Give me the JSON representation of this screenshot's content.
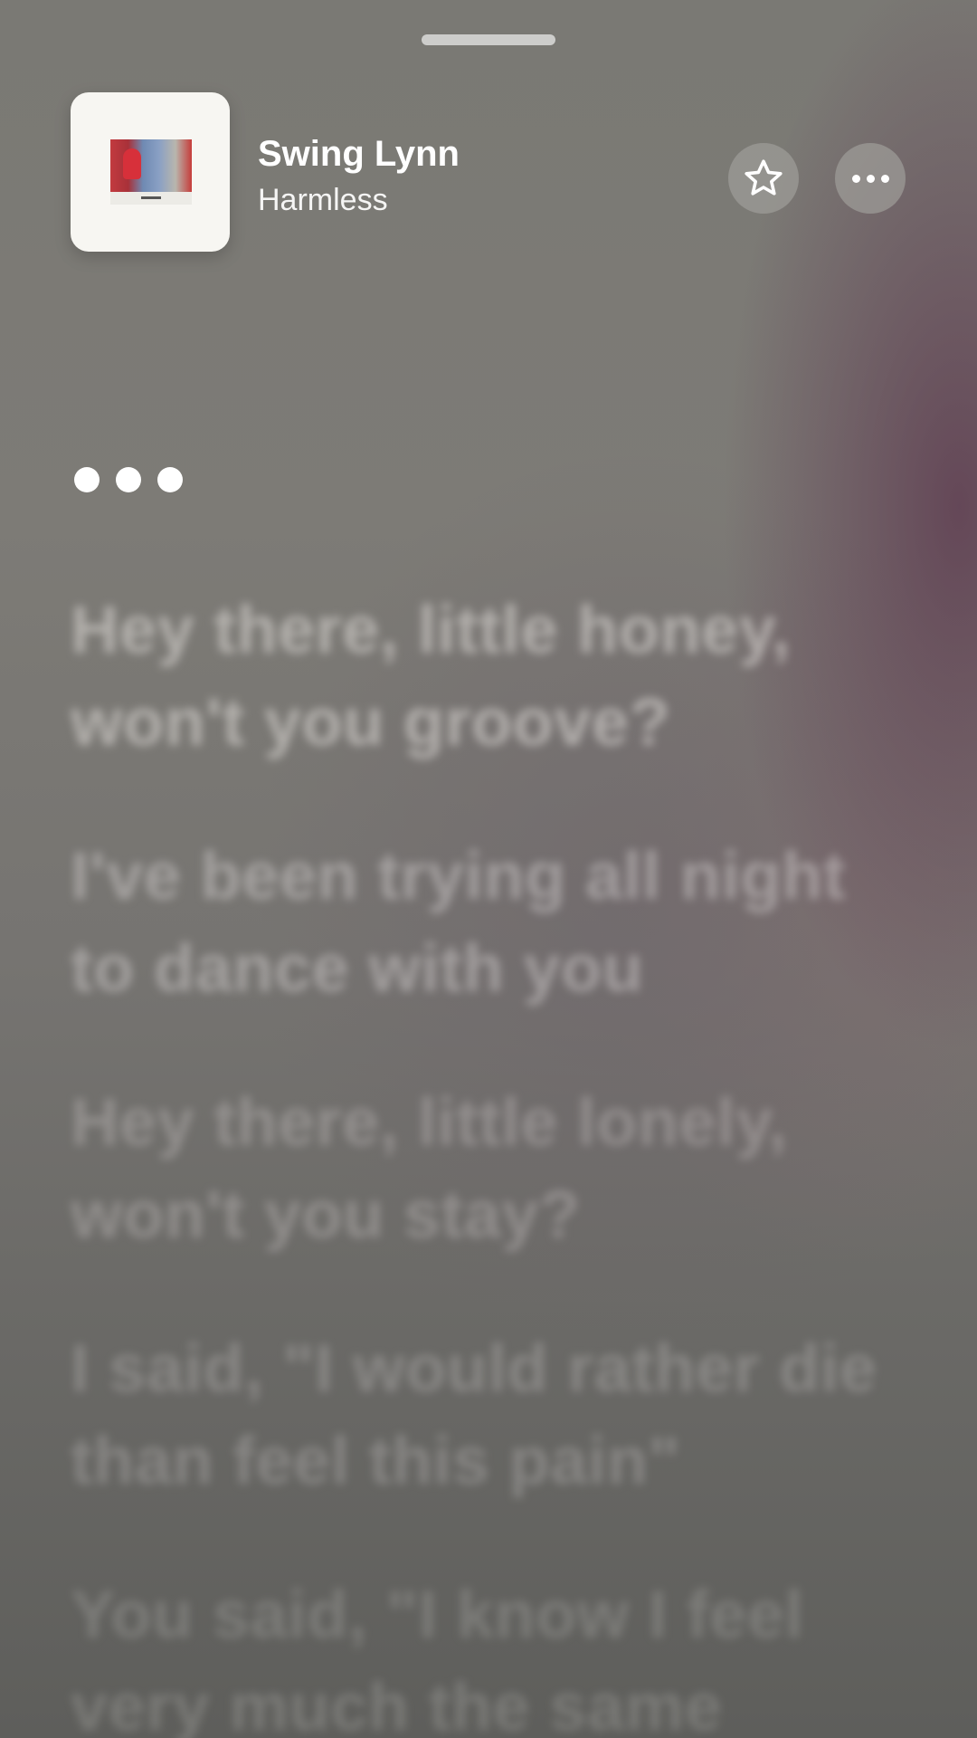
{
  "track": {
    "title": "Swing Lynn",
    "artist": "Harmless"
  },
  "actions": {
    "favorite_icon": "star-outline-icon",
    "more_icon": "ellipsis-icon"
  },
  "status": {
    "indicator_icon": "three-dots-waiting-icon"
  },
  "lyrics": [
    {
      "text": "Hey there, little honey, won't you groove?"
    },
    {
      "text": "I've been trying all night to dance with you"
    },
    {
      "text": "Hey there, little lonely, won't you stay?"
    },
    {
      "text": "I said, \"I would rather die than feel this pain\""
    },
    {
      "text": "You said, \"I know I feel very much the same"
    }
  ],
  "colors": {
    "text": "#ffffff",
    "button_bg": "#a09e9a",
    "accent_tint": "#603e52"
  }
}
